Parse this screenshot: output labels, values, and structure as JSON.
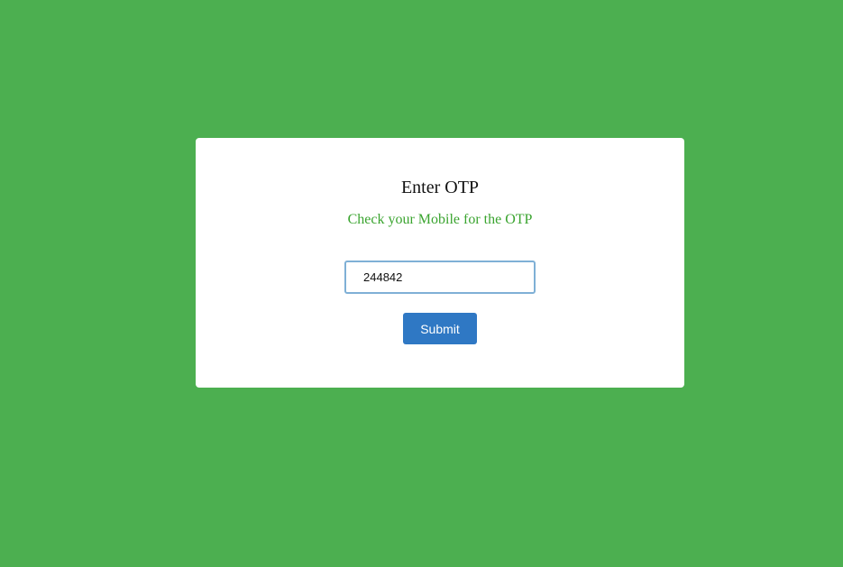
{
  "otp_card": {
    "title": "Enter OTP",
    "subtitle": "Check your Mobile for the OTP",
    "otp_input": {
      "value": "244842",
      "placeholder": ""
    },
    "submit_label": "Submit"
  },
  "colors": {
    "background": "#4caf50",
    "card": "#ffffff",
    "subtitle_text": "#3aa42f",
    "button": "#2f78c4",
    "input_border": "#7fb0d6"
  }
}
